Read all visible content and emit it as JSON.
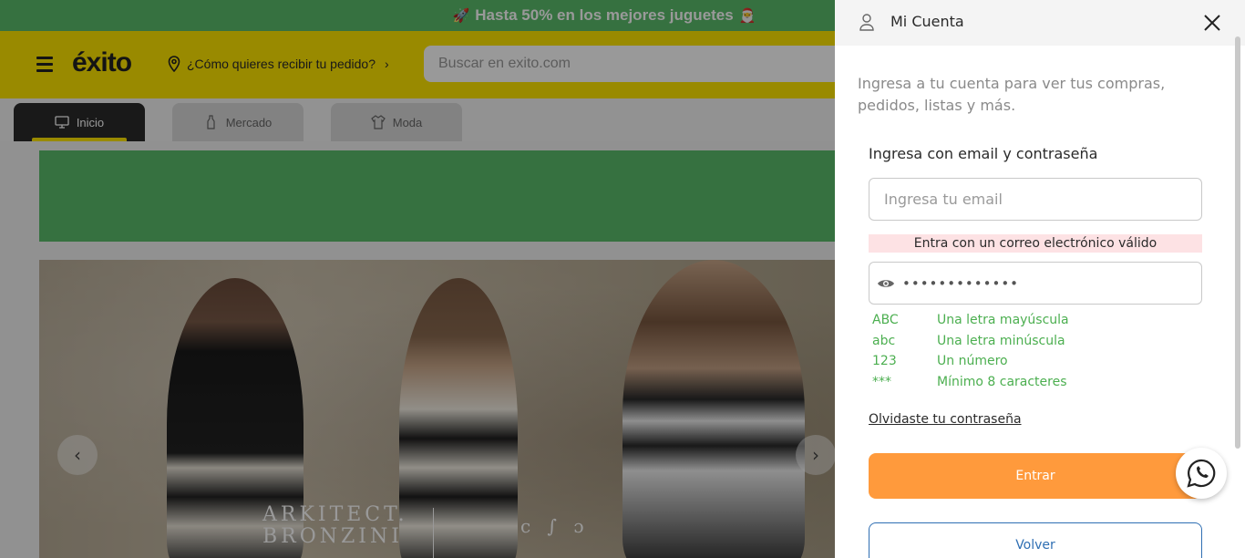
{
  "promo": {
    "text": "Hasta 50% en los mejores juguetes",
    "left_emoji": "🚀",
    "right_emoji": "🎅"
  },
  "header": {
    "logo": "éxito",
    "delivery_label": "¿Cómo quieres recibir tu pedido?",
    "search_placeholder": "Buscar en exito.com"
  },
  "tabs": [
    {
      "label": "Inicio",
      "icon": "monitor-icon",
      "active": true
    },
    {
      "label": "Mercado",
      "icon": "bottle-icon",
      "active": false
    },
    {
      "label": "Moda",
      "icon": "shirt-icon",
      "active": false
    }
  ],
  "hero": {
    "brand_primary": "ARKITECT.",
    "brand_secondary": "BRONZINI",
    "brand_tertiary": "c ∫ ɔ"
  },
  "panel": {
    "title": "Mi Cuenta",
    "intro": "Ingresa a tu cuenta para ver tus compras, pedidos, listas y más.",
    "form_title": "Ingresa con email y contraseña",
    "email_placeholder": "Ingresa tu email",
    "email_error": "Entra con un correo electrónico válido",
    "password_mask": "•••••••••••••",
    "password_rules": [
      {
        "code": "ABC",
        "text": "Una letra mayúscula"
      },
      {
        "code": "abc",
        "text": "Una letra minúscula"
      },
      {
        "code": "123",
        "text": "Un número"
      },
      {
        "code": "***",
        "text": "Mínimo 8 caracteres"
      }
    ],
    "forgot_link": "Olvidaste tu contraseña",
    "submit_label": "Entrar",
    "back_label": "Volver"
  },
  "colors": {
    "promo_green": "#5bbd6b",
    "header_yellow": "#ffe600",
    "submit_orange": "#ff9a3c",
    "rule_green": "#4caf50",
    "error_bg": "#fde2e4",
    "back_blue": "#2f6fb3"
  }
}
